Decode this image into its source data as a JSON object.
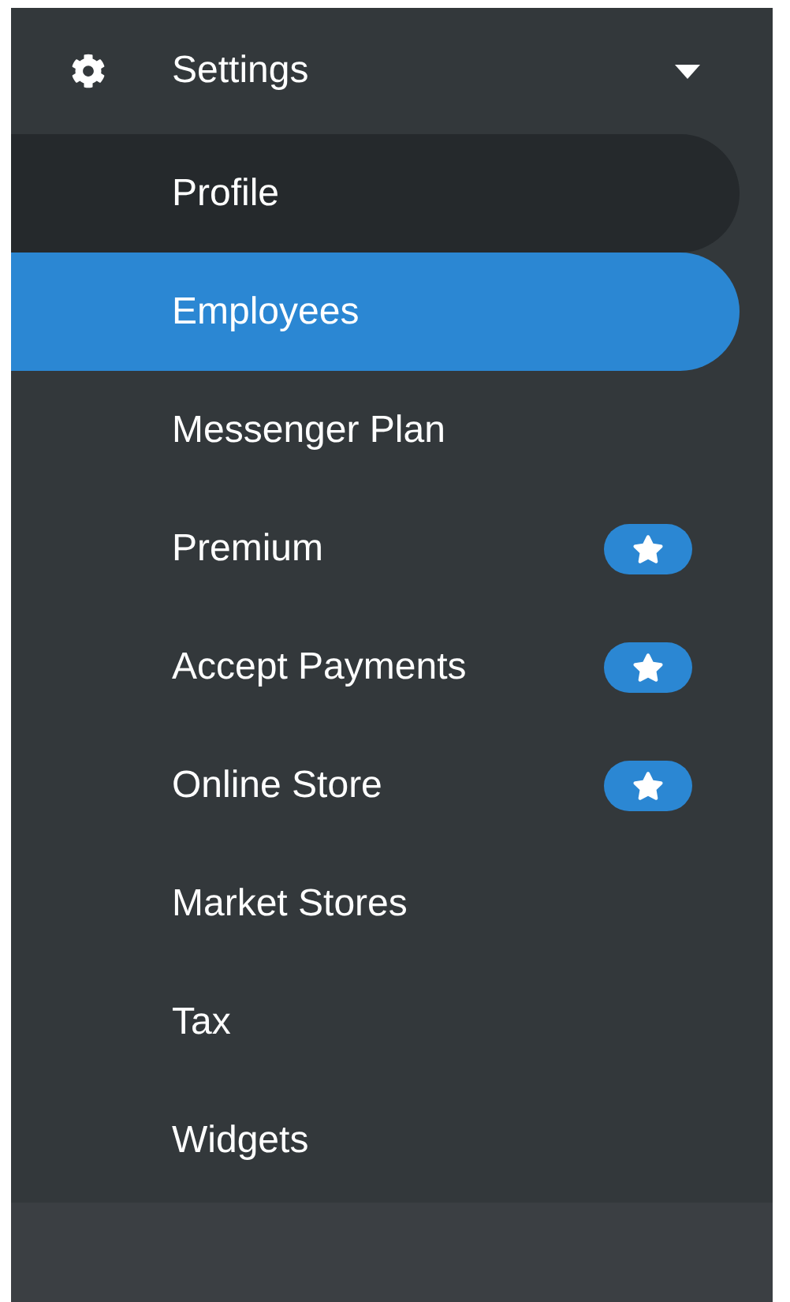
{
  "section": {
    "title": "Settings",
    "expanded": true
  },
  "items": [
    {
      "label": "Profile",
      "selected": false,
      "hovered": true,
      "premium": false
    },
    {
      "label": "Employees",
      "selected": true,
      "hovered": false,
      "premium": false
    },
    {
      "label": "Messenger Plan",
      "selected": false,
      "hovered": false,
      "premium": false
    },
    {
      "label": "Premium",
      "selected": false,
      "hovered": false,
      "premium": true
    },
    {
      "label": "Accept Payments",
      "selected": false,
      "hovered": false,
      "premium": true
    },
    {
      "label": "Online Store",
      "selected": false,
      "hovered": false,
      "premium": true
    },
    {
      "label": "Market Stores",
      "selected": false,
      "hovered": false,
      "premium": false
    },
    {
      "label": "Tax",
      "selected": false,
      "hovered": false,
      "premium": false
    },
    {
      "label": "Widgets",
      "selected": false,
      "hovered": false,
      "premium": false
    }
  ]
}
